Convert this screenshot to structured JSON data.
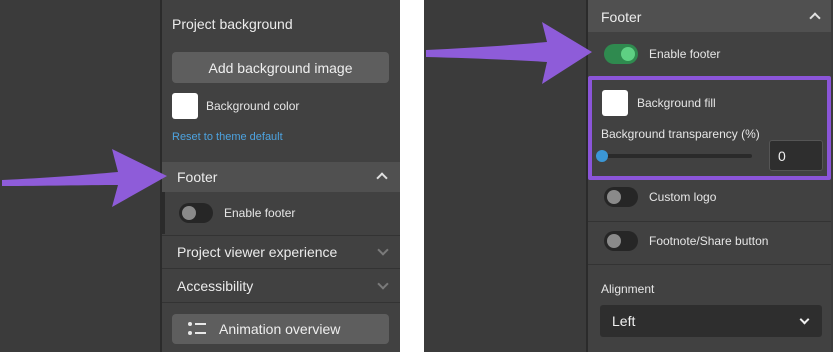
{
  "colors": {
    "accent_link": "#4da3e0",
    "highlight_purple": "#8b55d9",
    "toggle_on": "#2f8a4f",
    "slider_blue": "#3b97d6"
  },
  "left": {
    "project_background": {
      "title": "Project background",
      "add_image_label": "Add background image",
      "color_label": "Background color",
      "reset_link": "Reset to theme default"
    },
    "footer": {
      "title": "Footer",
      "enable_label": "Enable footer",
      "enabled": false
    },
    "viewer_section": {
      "title": "Project viewer experience"
    },
    "accessibility_section": {
      "title": "Accessibility"
    },
    "animation_button": {
      "label": "Animation overview",
      "icon": "list-icon"
    }
  },
  "right": {
    "footer": {
      "title": "Footer",
      "enable_label": "Enable footer",
      "enabled": true
    },
    "background_fill": {
      "label": "Background fill",
      "transparency_label": "Background transparency (%)",
      "transparency_value": "0",
      "transparency_fraction": 0
    },
    "custom_logo": {
      "label": "Custom logo",
      "enabled": false
    },
    "footnote": {
      "label": "Footnote/Share button",
      "enabled": false
    },
    "alignment": {
      "label": "Alignment",
      "value": "Left"
    }
  }
}
